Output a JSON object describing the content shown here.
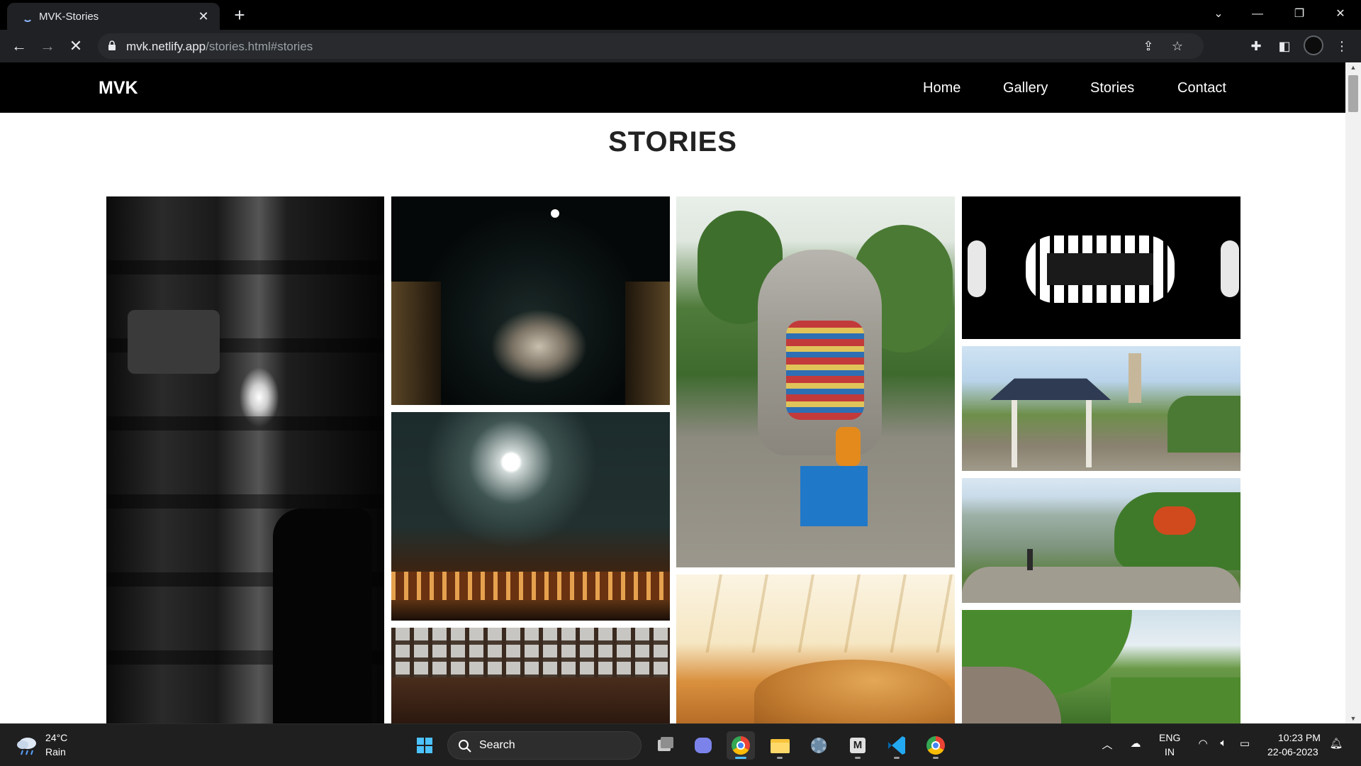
{
  "browser": {
    "tab_title": "MVK-Stories",
    "url_host": "mvk.netlify.app",
    "url_path": "/stories.html#stories"
  },
  "site": {
    "logo": "MVK",
    "nav": [
      "Home",
      "Gallery",
      "Stories",
      "Contact"
    ],
    "heading": "STORIES"
  },
  "taskbar": {
    "weather_temp": "24°C",
    "weather_desc": "Rain",
    "search_label": "Search",
    "lang_top": "ENG",
    "lang_bottom": "IN",
    "time": "10:23 PM",
    "date": "22-06-2023"
  }
}
